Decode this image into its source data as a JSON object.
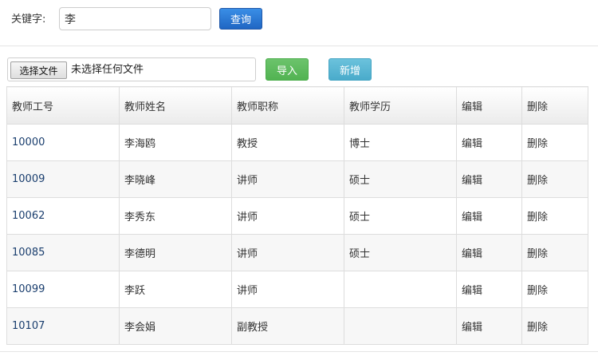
{
  "search": {
    "label": "关键字:",
    "value": "李",
    "button": "查询"
  },
  "upload": {
    "choose_file": "选择文件",
    "no_file": "未选择任何文件",
    "import": "导入",
    "add": "新增"
  },
  "table": {
    "headers": [
      "教师工号",
      "教师姓名",
      "教师职称",
      "教师学历",
      "编辑",
      "删除"
    ],
    "rows": [
      [
        "10000",
        "李海鸥",
        "教授",
        "博士",
        "编辑",
        "删除"
      ],
      [
        "10009",
        "李晓峰",
        "讲师",
        "硕士",
        "编辑",
        "删除"
      ],
      [
        "10062",
        "李秀东",
        "讲师",
        "硕士",
        "编辑",
        "删除"
      ],
      [
        "10085",
        "李德明",
        "讲师",
        "硕士",
        "编辑",
        "删除"
      ],
      [
        "10099",
        "李跃",
        "讲师",
        "",
        "编辑",
        "删除"
      ],
      [
        "10107",
        "李会娟",
        "副教授",
        "",
        "编辑",
        "删除"
      ]
    ]
  }
}
